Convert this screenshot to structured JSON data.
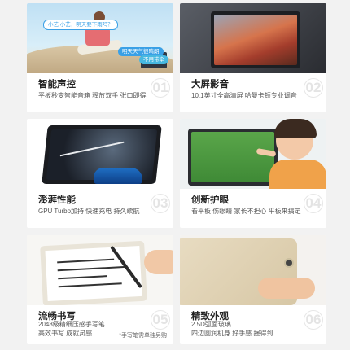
{
  "cards": [
    {
      "title": "智能声控",
      "subtitle": "平板秒变智能音箱 释放双手 张口即得",
      "number": "01",
      "bubbles": [
        "小艺 小艺，明天要下雨吗？",
        "明天天气很晴朗",
        "不用带伞"
      ]
    },
    {
      "title": "大屏影音",
      "subtitle": "10.1英寸全高清屏 哈曼卡顿专业调音",
      "number": "02"
    },
    {
      "title": "澎湃性能",
      "subtitle": "GPU Turbo加持 快速充电 持久续航",
      "number": "03"
    },
    {
      "title": "创新护眼",
      "subtitle": "看平板  伤眼睛  家长不担心  平板来搞定",
      "number": "04"
    },
    {
      "title": "流畅书写",
      "subtitle_lines": [
        "2048级精细压感手写笔",
        "高效书写  成就灵感"
      ],
      "number": "05",
      "note": "*手写笔需单独另购"
    },
    {
      "title": "精致外观",
      "subtitle_lines": [
        "2.5D弧面玻璃",
        "四边圆润机身  好手感  握得到"
      ],
      "number": "06"
    }
  ]
}
